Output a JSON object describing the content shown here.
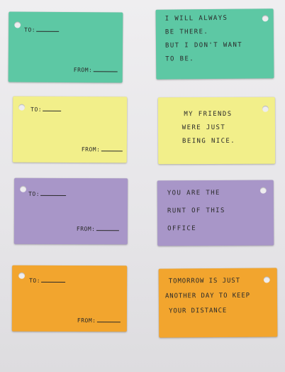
{
  "colors": {
    "green": "#5dc8a4",
    "yellow": "#f2ef8a",
    "purple": "#a896c8",
    "orange": "#f2a52e"
  },
  "tag_labels": {
    "to": "TO:",
    "from": "FROM:"
  },
  "messages": [
    {
      "lines": [
        "I WILL ALWAYS",
        "BE THERE.",
        "BUT I DON'T WANT",
        "TO BE."
      ]
    },
    {
      "lines": [
        "MY FRIENDS",
        "WERE JUST",
        "BEING NICE."
      ]
    },
    {
      "lines": [
        "YOU ARE THE",
        "RUNT OF THIS",
        "OFFICE"
      ]
    },
    {
      "lines": [
        "TOMORROW IS JUST",
        "ANOTHER DAY TO KEEP",
        "YOUR DISTANCE"
      ]
    }
  ]
}
